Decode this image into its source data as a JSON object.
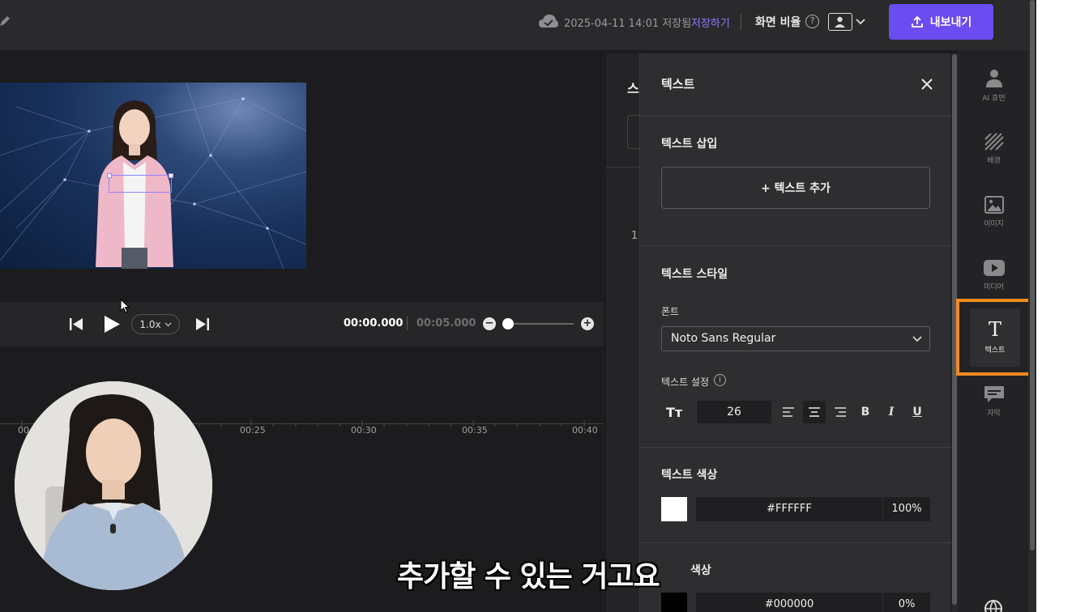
{
  "topbar": {
    "save_time": "2025-04-11 14:01 저장됨",
    "save_now": "저장하기",
    "ratio_label": "화면 비율",
    "export_label": "내보내기"
  },
  "player": {
    "speed": "1.0x",
    "current_time": "00:00.000",
    "total_time": "00:05.000",
    "zoom_level": 0
  },
  "timeline": {
    "labels": [
      "00",
      "00:25",
      "00:30",
      "00:35",
      "00:40"
    ]
  },
  "middle": {
    "heading_fragment": "스",
    "number": "1"
  },
  "panel": {
    "title": "텍스트",
    "insert_title": "텍스트 삽입",
    "add_text_label": "+ 텍스트 추가",
    "style_title": "텍스트 스타일",
    "font_label": "폰트",
    "font_value": "Noto Sans Regular",
    "settings_label": "텍스트 설정",
    "font_size": "26",
    "size_icon": "Tт",
    "bold": "B",
    "italic": "I",
    "underline": "U",
    "color_title": "텍스트 색상",
    "text_color": "#FFFFFF",
    "text_opacity": "100%",
    "bg_color_title_fragment": "색상",
    "bg_color": "#000000",
    "bg_opacity": "0%"
  },
  "rail": {
    "items": [
      {
        "label": "AI 휴먼",
        "icon": "person-icon"
      },
      {
        "label": "배경",
        "icon": "background-icon"
      },
      {
        "label": "이미지",
        "icon": "image-icon"
      },
      {
        "label": "미디어",
        "icon": "media-icon"
      },
      {
        "label": "텍스트",
        "icon": "text-icon"
      },
      {
        "label": "자막",
        "icon": "subtitle-icon"
      }
    ],
    "active_glyph": "T"
  },
  "subtitle": "추가할 수 있는 거고요",
  "colors": {
    "accent": "#6a4cf0",
    "highlight": "#f28a1f",
    "link": "#8b7cff"
  }
}
